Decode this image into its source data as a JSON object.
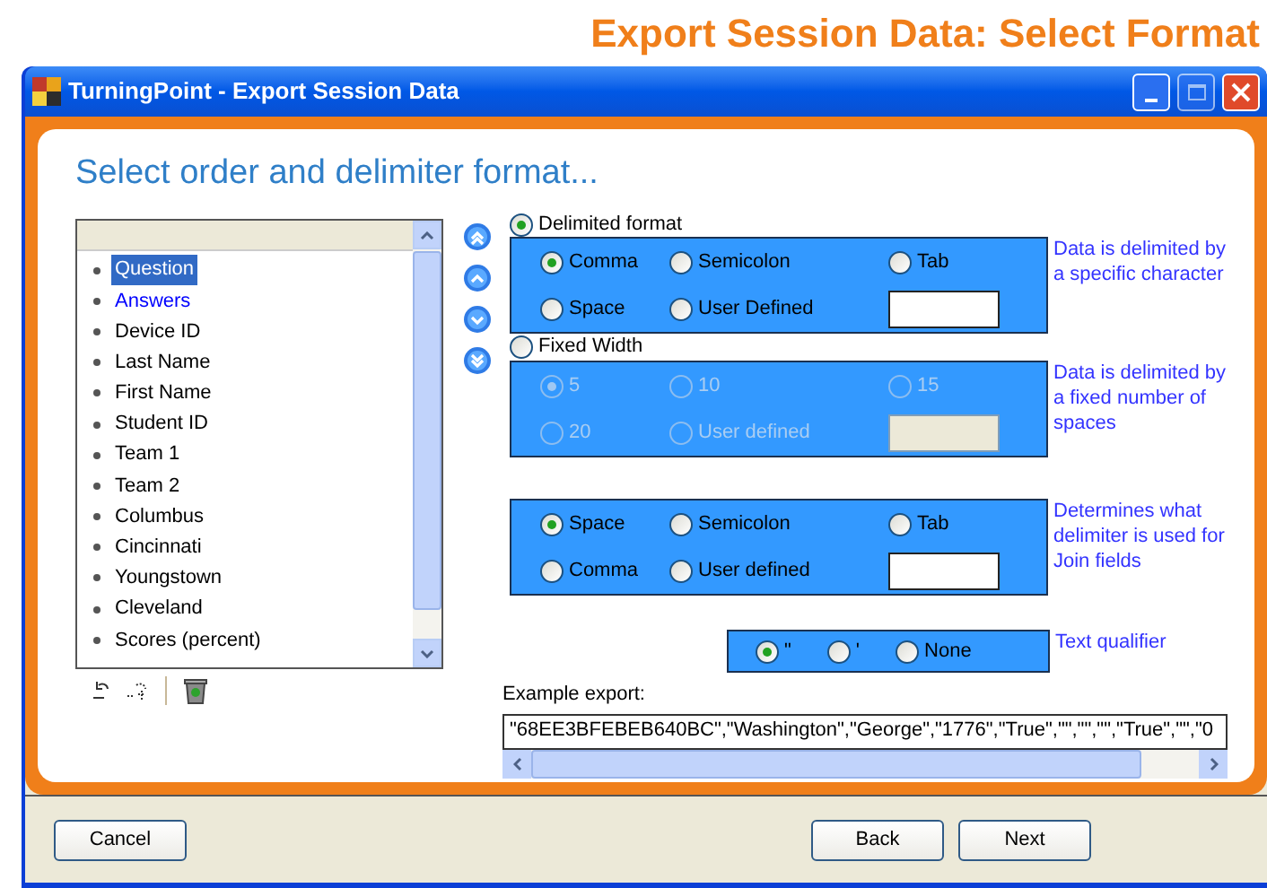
{
  "page_heading": "Export Session Data: Select Format",
  "window": {
    "title": "TurningPoint - Export Session Data"
  },
  "wizard_heading": "Select order and delimiter format...",
  "field_list": [
    {
      "label": "Question",
      "selected": true,
      "highlighted": false
    },
    {
      "label": "Answers",
      "selected": false,
      "highlighted": true
    },
    {
      "label": "Device ID",
      "selected": false,
      "highlighted": false
    },
    {
      "label": "Last Name",
      "selected": false,
      "highlighted": false
    },
    {
      "label": "First Name",
      "selected": false,
      "highlighted": false
    },
    {
      "label": "Student ID",
      "selected": false,
      "highlighted": false
    },
    {
      "label": "Team 1",
      "selected": false,
      "highlighted": false
    },
    {
      "label": "Team 2",
      "selected": false,
      "highlighted": false
    },
    {
      "label": "Columbus",
      "selected": false,
      "highlighted": false
    },
    {
      "label": "Cincinnati",
      "selected": false,
      "highlighted": false
    },
    {
      "label": "Youngstown",
      "selected": false,
      "highlighted": false
    },
    {
      "label": "Cleveland",
      "selected": false,
      "highlighted": false
    },
    {
      "label": "Scores (percent)",
      "selected": false,
      "highlighted": false
    }
  ],
  "delimited": {
    "label": "Delimited format",
    "selected": true,
    "disabled": false,
    "note": "Data is delimited by a specific character",
    "options": [
      {
        "label": "Comma",
        "selected": true
      },
      {
        "label": "Semicolon",
        "selected": false
      },
      {
        "label": "Tab",
        "selected": false
      },
      {
        "label": "Space",
        "selected": false
      },
      {
        "label": "User Defined",
        "selected": false
      }
    ]
  },
  "fixed_width": {
    "label": "Fixed Width",
    "selected": false,
    "disabled": true,
    "note": "Data is delimited by a fixed number of spaces",
    "options": [
      {
        "label": "5",
        "selected": true
      },
      {
        "label": "10",
        "selected": false
      },
      {
        "label": "15",
        "selected": false
      },
      {
        "label": "20",
        "selected": false
      },
      {
        "label": "User defined",
        "selected": false
      }
    ]
  },
  "join": {
    "disabled": false,
    "note": "Determines what delimiter is used for Join fields",
    "options": [
      {
        "label": "Space",
        "selected": true
      },
      {
        "label": "Semicolon",
        "selected": false
      },
      {
        "label": "Tab",
        "selected": false
      },
      {
        "label": "Comma",
        "selected": false
      },
      {
        "label": "User defined",
        "selected": false
      }
    ]
  },
  "qualifier": {
    "note": "Text qualifier",
    "options": [
      {
        "label": "\"",
        "selected": true
      },
      {
        "label": "'",
        "selected": false
      },
      {
        "label": "None",
        "selected": false
      }
    ]
  },
  "example": {
    "label": "Example export:",
    "value": "\"68EE3BFEBEB640BC\",\"Washington\",\"George\",\"1776\",\"True\",\"\",\"\",\"\",\"True\",\"\",\"0"
  },
  "buttons": {
    "cancel": "Cancel",
    "back": "Back",
    "next": "Next"
  }
}
